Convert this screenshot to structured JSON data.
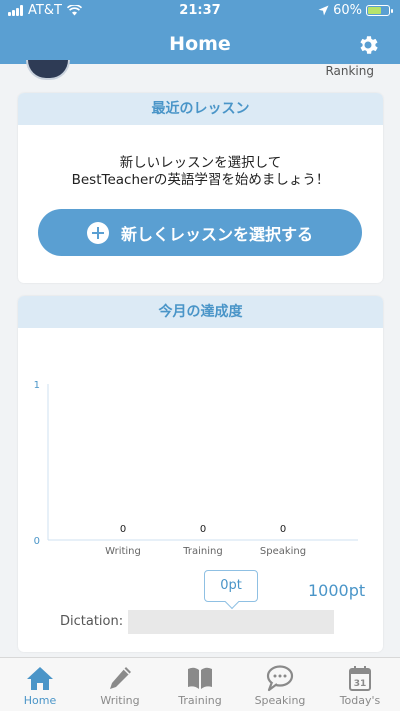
{
  "status": {
    "carrier": "AT&T",
    "time": "21:37",
    "battery": "60%",
    "battery_level": 0.6
  },
  "header": {
    "title": "Home",
    "settings_icon": "gear-icon"
  },
  "profile": {
    "ranking_label": "Ranking"
  },
  "lessons": {
    "title": "最近のレッスン",
    "message_line1": "新しいレッスンを選択して",
    "message_line2": "BestTeacherの英語学習を始めましょう！",
    "button_label": "新しくレッスンを選択する",
    "button_icon": "plus-circle-icon"
  },
  "achievement": {
    "title": "今月の達成度",
    "current_points": "0pt",
    "target_points": "1000pt",
    "dictation_label": "Dictation:",
    "dictation_progress": 0
  },
  "chart_data": {
    "type": "bar",
    "categories": [
      "Writing",
      "Training",
      "Speaking"
    ],
    "values": [
      0,
      0,
      0
    ],
    "data_labels": [
      "0",
      "0",
      "0"
    ],
    "ylim": [
      0,
      1
    ],
    "y_ticks": [
      "0",
      "1"
    ],
    "grid": false,
    "axis_color": "#4a95c8"
  },
  "tabbar": {
    "active": "home",
    "items": [
      {
        "key": "home",
        "label": "Home",
        "icon": "home-icon"
      },
      {
        "key": "writing",
        "label": "Writing",
        "icon": "pencil-icon"
      },
      {
        "key": "training",
        "label": "Training",
        "icon": "book-icon"
      },
      {
        "key": "speaking",
        "label": "Speaking",
        "icon": "speech-bubble-icon"
      },
      {
        "key": "todays",
        "label": "Today's",
        "icon": "calendar-icon",
        "badge": "31"
      }
    ],
    "active_color": "#4a95c8",
    "inactive_color": "#8a8a8a"
  },
  "colors": {
    "brand": "#5a9fd2",
    "accent": "#4a95c8",
    "card_header": "#dceaf5"
  }
}
